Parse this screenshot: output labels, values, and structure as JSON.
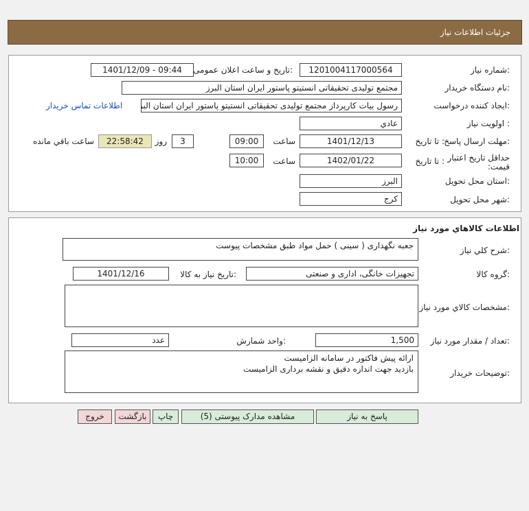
{
  "window": {
    "title": "جزئیات اطلاعات نیاز"
  },
  "need_info": {
    "need_number_label": "شماره نیاز:",
    "need_number": "1201004117000564",
    "announce_label": "تاریخ و ساعت اعلان عمومی:",
    "announce_value": "1401/12/09 - 09:44",
    "buyer_label": "نام دستگاه خریدار:",
    "buyer_value": "مجتمع تولیدی تحقیقاتی انستیتو پاستور ایران استان البرز",
    "creator_label": "ایجاد کننده درخواست:",
    "creator_value": "رسول بیات کارپرداز مجتمع تولیدی تحقیقاتی انستیتو پاستور ایران استان البرز",
    "contact_link": "اطلاعات تماس خریدار",
    "priority_label": "اولویت نیاز :",
    "priority_value": "عادي",
    "deadline_label": "مهلت ارسال پاسخ:",
    "to_date_label": "تا تاریخ :",
    "deadline_date": "1401/12/13",
    "time_label": "ساعت",
    "deadline_time": "09:00",
    "days_value": "3",
    "days_label": "روز و",
    "remaining_time": "22:58:42",
    "remaining_label": "ساعت باقي مانده",
    "validity_label": "حداقل تاریخ اعتبار قیمت:",
    "validity_date": "1402/01/22",
    "validity_time": "10:00",
    "province_label": "استان محل تحویل:",
    "province_value": "البرز",
    "city_label": "شهر محل تحویل:",
    "city_value": "کرج"
  },
  "goods": {
    "section_title": "اطلاعات کالاهاي مورد نياز",
    "desc_label": "شرح کلي نياز:",
    "desc_value": "جعبه نگهداری ( سینی ) حمل مواد طبق مشخصات پیوست",
    "group_label": "گروه کالا:",
    "group_value": "تجهیزات خانگی، اداری و صنعتی",
    "need_date_label": "تاریخ نیاز به کالا:",
    "need_date_value": "1401/12/16",
    "specs_label": "مشخصات کالاي مورد نياز:",
    "specs_value": "",
    "qty_label": "تعداد / مقدار مورد نیاز:",
    "qty_value": "1,500",
    "unit_label": "واحد شمارش:",
    "unit_value": "عدد",
    "notes_label": "توضيحات خريدار:",
    "notes_value": "ارائه پیش فاکتور در سامانه الزامیست\nبازدید جهت اندازه دقیق و نقشه برداری الزامیست"
  },
  "buttons": {
    "reply": "پاسخ به نیاز",
    "docs": "مشاهده مدارک پیوستی (5)",
    "print": "چاپ",
    "back": "بازگشت",
    "exit": "خروج"
  },
  "colors": {
    "title_bg": "#8b6b43",
    "button_green": "#d9ecd9",
    "button_pink": "#f3d6d6",
    "link": "#1a4fb3"
  }
}
